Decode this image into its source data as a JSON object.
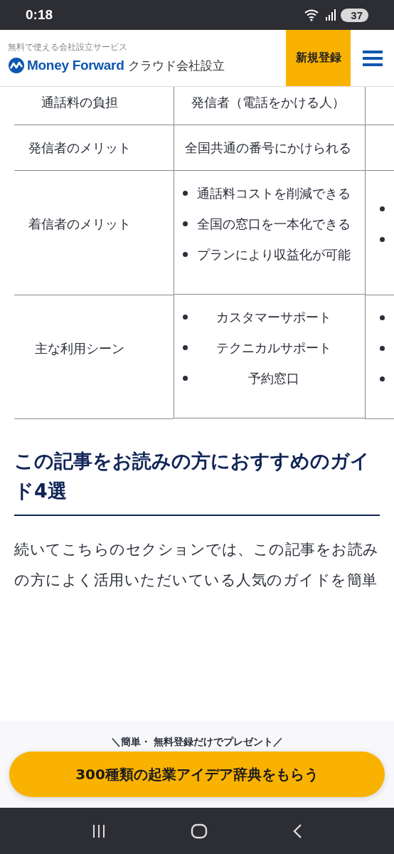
{
  "status_bar": {
    "time": "0:18",
    "battery": "37"
  },
  "header": {
    "tagline": "無料で使える会社設立サービス",
    "brand": "Money Forward",
    "product": "クラウド会社設立",
    "register_button": "新規登録"
  },
  "table": {
    "rows": [
      {
        "cells": [
          {
            "kind": "text",
            "text": "通話料の負担"
          },
          {
            "kind": "text",
            "text": "発信者（電話をかける人）"
          },
          {
            "kind": "empty"
          }
        ]
      },
      {
        "cells": [
          {
            "kind": "text",
            "text": "発信者のメリット"
          },
          {
            "kind": "text",
            "text": "全国共通の番号にかけられる"
          },
          {
            "kind": "empty"
          }
        ]
      },
      {
        "cells": [
          {
            "kind": "text",
            "text": "着信者のメリット"
          },
          {
            "kind": "list",
            "items": [
              "通話料コストを削減できる",
              "全国の窓口を一本化できる",
              "プランにより収益化が可能"
            ]
          },
          {
            "kind": "bullets",
            "bullets": [
              {
                "kind": "bullet"
              },
              {
                "kind": "bullet"
              }
            ]
          }
        ]
      },
      {
        "cells": [
          {
            "kind": "text",
            "text": "主な利用シーン"
          },
          {
            "kind": "list",
            "items": [
              "カスタマーサポート",
              "テクニカルサポート",
              "予約窓口"
            ]
          },
          {
            "kind": "bullets",
            "bullets": [
              {
                "kind": "bullet"
              },
              {
                "kind": "bullet"
              },
              {
                "kind": "bullet"
              }
            ]
          }
        ]
      }
    ]
  },
  "section": {
    "heading": "この記事をお読みの方におすすめのガイド4選",
    "paragraph": "続いてこちらのセクションでは、この記事をお読みの方によく活用いただいている人気のガイドを簡単"
  },
  "cta": {
    "caption": "＼簡単・ 無料登録だけでプレゼント／",
    "button": "300種類の起業アイデア辞典をもらう"
  }
}
